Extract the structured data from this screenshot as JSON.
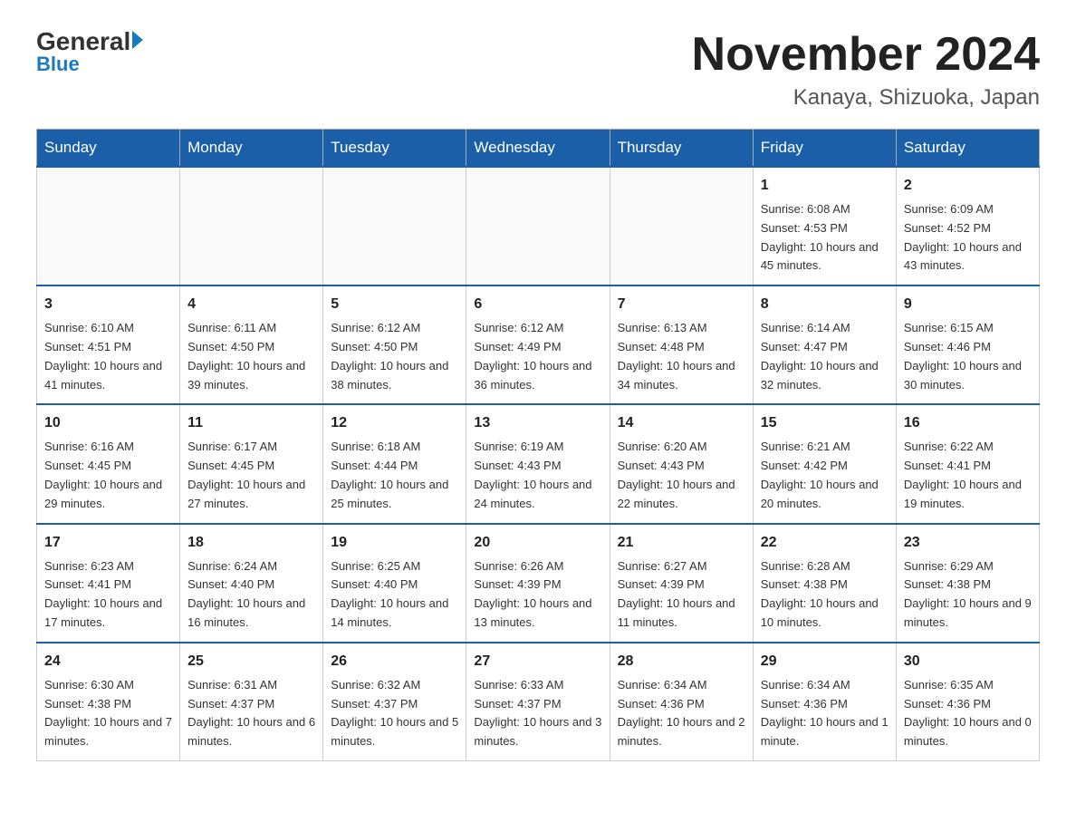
{
  "logo": {
    "general": "General",
    "blue": "Blue",
    "tagline": "Blue"
  },
  "header": {
    "month": "November 2024",
    "location": "Kanaya, Shizuoka, Japan"
  },
  "days_of_week": [
    "Sunday",
    "Monday",
    "Tuesday",
    "Wednesday",
    "Thursday",
    "Friday",
    "Saturday"
  ],
  "weeks": [
    {
      "days": [
        {
          "date": "",
          "info": ""
        },
        {
          "date": "",
          "info": ""
        },
        {
          "date": "",
          "info": ""
        },
        {
          "date": "",
          "info": ""
        },
        {
          "date": "",
          "info": ""
        },
        {
          "date": "1",
          "info": "Sunrise: 6:08 AM\nSunset: 4:53 PM\nDaylight: 10 hours and 45 minutes."
        },
        {
          "date": "2",
          "info": "Sunrise: 6:09 AM\nSunset: 4:52 PM\nDaylight: 10 hours and 43 minutes."
        }
      ]
    },
    {
      "days": [
        {
          "date": "3",
          "info": "Sunrise: 6:10 AM\nSunset: 4:51 PM\nDaylight: 10 hours and 41 minutes."
        },
        {
          "date": "4",
          "info": "Sunrise: 6:11 AM\nSunset: 4:50 PM\nDaylight: 10 hours and 39 minutes."
        },
        {
          "date": "5",
          "info": "Sunrise: 6:12 AM\nSunset: 4:50 PM\nDaylight: 10 hours and 38 minutes."
        },
        {
          "date": "6",
          "info": "Sunrise: 6:12 AM\nSunset: 4:49 PM\nDaylight: 10 hours and 36 minutes."
        },
        {
          "date": "7",
          "info": "Sunrise: 6:13 AM\nSunset: 4:48 PM\nDaylight: 10 hours and 34 minutes."
        },
        {
          "date": "8",
          "info": "Sunrise: 6:14 AM\nSunset: 4:47 PM\nDaylight: 10 hours and 32 minutes."
        },
        {
          "date": "9",
          "info": "Sunrise: 6:15 AM\nSunset: 4:46 PM\nDaylight: 10 hours and 30 minutes."
        }
      ]
    },
    {
      "days": [
        {
          "date": "10",
          "info": "Sunrise: 6:16 AM\nSunset: 4:45 PM\nDaylight: 10 hours and 29 minutes."
        },
        {
          "date": "11",
          "info": "Sunrise: 6:17 AM\nSunset: 4:45 PM\nDaylight: 10 hours and 27 minutes."
        },
        {
          "date": "12",
          "info": "Sunrise: 6:18 AM\nSunset: 4:44 PM\nDaylight: 10 hours and 25 minutes."
        },
        {
          "date": "13",
          "info": "Sunrise: 6:19 AM\nSunset: 4:43 PM\nDaylight: 10 hours and 24 minutes."
        },
        {
          "date": "14",
          "info": "Sunrise: 6:20 AM\nSunset: 4:43 PM\nDaylight: 10 hours and 22 minutes."
        },
        {
          "date": "15",
          "info": "Sunrise: 6:21 AM\nSunset: 4:42 PM\nDaylight: 10 hours and 20 minutes."
        },
        {
          "date": "16",
          "info": "Sunrise: 6:22 AM\nSunset: 4:41 PM\nDaylight: 10 hours and 19 minutes."
        }
      ]
    },
    {
      "days": [
        {
          "date": "17",
          "info": "Sunrise: 6:23 AM\nSunset: 4:41 PM\nDaylight: 10 hours and 17 minutes."
        },
        {
          "date": "18",
          "info": "Sunrise: 6:24 AM\nSunset: 4:40 PM\nDaylight: 10 hours and 16 minutes."
        },
        {
          "date": "19",
          "info": "Sunrise: 6:25 AM\nSunset: 4:40 PM\nDaylight: 10 hours and 14 minutes."
        },
        {
          "date": "20",
          "info": "Sunrise: 6:26 AM\nSunset: 4:39 PM\nDaylight: 10 hours and 13 minutes."
        },
        {
          "date": "21",
          "info": "Sunrise: 6:27 AM\nSunset: 4:39 PM\nDaylight: 10 hours and 11 minutes."
        },
        {
          "date": "22",
          "info": "Sunrise: 6:28 AM\nSunset: 4:38 PM\nDaylight: 10 hours and 10 minutes."
        },
        {
          "date": "23",
          "info": "Sunrise: 6:29 AM\nSunset: 4:38 PM\nDaylight: 10 hours and 9 minutes."
        }
      ]
    },
    {
      "days": [
        {
          "date": "24",
          "info": "Sunrise: 6:30 AM\nSunset: 4:38 PM\nDaylight: 10 hours and 7 minutes."
        },
        {
          "date": "25",
          "info": "Sunrise: 6:31 AM\nSunset: 4:37 PM\nDaylight: 10 hours and 6 minutes."
        },
        {
          "date": "26",
          "info": "Sunrise: 6:32 AM\nSunset: 4:37 PM\nDaylight: 10 hours and 5 minutes."
        },
        {
          "date": "27",
          "info": "Sunrise: 6:33 AM\nSunset: 4:37 PM\nDaylight: 10 hours and 3 minutes."
        },
        {
          "date": "28",
          "info": "Sunrise: 6:34 AM\nSunset: 4:36 PM\nDaylight: 10 hours and 2 minutes."
        },
        {
          "date": "29",
          "info": "Sunrise: 6:34 AM\nSunset: 4:36 PM\nDaylight: 10 hours and 1 minute."
        },
        {
          "date": "30",
          "info": "Sunrise: 6:35 AM\nSunset: 4:36 PM\nDaylight: 10 hours and 0 minutes."
        }
      ]
    }
  ]
}
